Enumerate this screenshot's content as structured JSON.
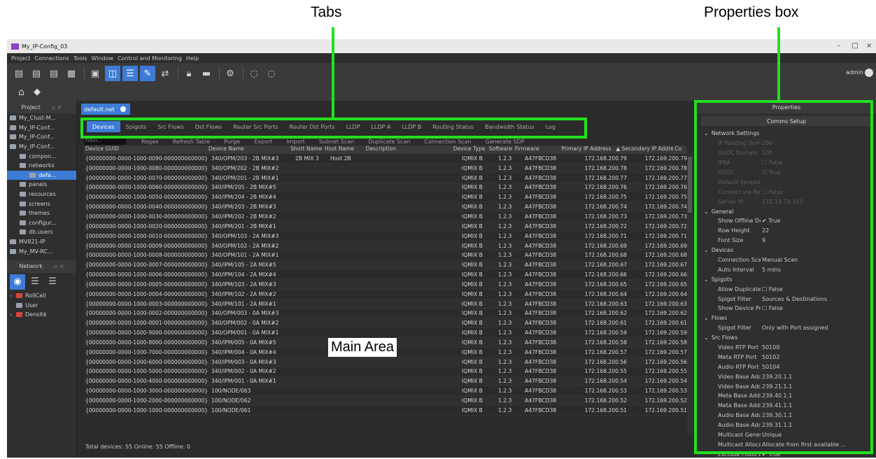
{
  "annotations": {
    "tabs": "Tabs",
    "properties_box": "Properties box",
    "main_area": "Main Area"
  },
  "window": {
    "title": "My_IP-Config_03",
    "minimize": "–",
    "maximize": "□",
    "close": "×"
  },
  "menu": [
    "Project",
    "Connections",
    "Tools",
    "Window",
    "Control and Monitoring",
    "Help"
  ],
  "toolbar": {
    "user": "admin"
  },
  "left_panel": {
    "project_title": "Project",
    "project_items": [
      {
        "label": "My_Clust-M...",
        "indent": 0,
        "sel": false
      },
      {
        "label": "My_IP-Conf...",
        "indent": 0,
        "sel": false
      },
      {
        "label": "My_IP-Conf...",
        "indent": 0,
        "sel": false
      },
      {
        "label": "My_IP-Conf...",
        "indent": 0,
        "sel": false
      },
      {
        "label": "compon...",
        "indent": 1,
        "sel": false
      },
      {
        "label": "networks",
        "indent": 1,
        "sel": false
      },
      {
        "label": "defa...",
        "indent": 2,
        "sel": true
      },
      {
        "label": "panels",
        "indent": 1,
        "sel": false
      },
      {
        "label": "resources",
        "indent": 1,
        "sel": false
      },
      {
        "label": "screens",
        "indent": 1,
        "sel": false
      },
      {
        "label": "themes",
        "indent": 1,
        "sel": false
      },
      {
        "label": "configur...",
        "indent": 1,
        "sel": false
      },
      {
        "label": "db.users",
        "indent": 1,
        "sel": false
      },
      {
        "label": "MV821-IP",
        "indent": 0,
        "sel": false
      },
      {
        "label": "My_MV-RC...",
        "indent": 0,
        "sel": false
      }
    ],
    "network_title": "Network",
    "network_items": [
      "RollCall",
      "User",
      "Densité"
    ]
  },
  "doc_tab": "default.net",
  "tabs": [
    "Devices",
    "Spigots",
    "Src Flows",
    "Dst Flows",
    "Router Src Ports",
    "Router Dst Ports",
    "LLDP",
    "LLDP A",
    "LLDP B",
    "Routing Status",
    "Bandwidth Status",
    "Log"
  ],
  "actions": {
    "filter_placeholder": "Filter...",
    "buttons": [
      "Regex",
      "Refresh Table",
      "Purge",
      "Export",
      "Import",
      "Subnet Scan",
      "Duplicate Scan",
      "Connection Scan",
      "Generate SDP"
    ]
  },
  "columns": [
    "Device GUID",
    "Device Name",
    "Short Name",
    "Host Name",
    "Description",
    "Device Type",
    "Software",
    "Firmware",
    "Primary IP Address",
    "▲ Secondary IP Address",
    "Co"
  ],
  "rows": [
    [
      "{00000000-0000-1000-0090-000000000000}",
      "340/OPM/203 - 2B MIX#3",
      "2B MIX 3",
      "Host 2B",
      "",
      "IQMIX B",
      "1.2.3",
      "A47FBCD38",
      "172.168.200.79",
      "172.169.200.79"
    ],
    [
      "{00000000-0000-1000-0080-000000000000}",
      "340/OPM/202 - 2B MIX#2",
      "",
      "",
      "",
      "IQMIX B",
      "1.2.3",
      "A47FBCD38",
      "172.168.200.78",
      "172.169.200.78"
    ],
    [
      "{00000000-0000-1000-0070-000000000000}",
      "340/OPM/201 - 2B MIX#1",
      "",
      "",
      "",
      "IQMIX B",
      "1.2.3",
      "A47FBCD38",
      "172.168.200.77",
      "172.169.200.77"
    ],
    [
      "{00000000-0000-1000-0060-000000000000}",
      "340/IPM/205 - 2B MIX#5",
      "",
      "",
      "",
      "IQMIX B",
      "1.2.3",
      "A47FBCD38",
      "172.168.200.76",
      "172.169.200.76"
    ],
    [
      "{00000000-0000-1000-0050-000000000000}",
      "340/IPM/204 - 2B MIX#4",
      "",
      "",
      "",
      "IQMIX B",
      "1.2.3",
      "A47FBCD38",
      "172.168.200.75",
      "172.169.200.75"
    ],
    [
      "{00000000-0000-1000-0040-000000000000}",
      "340/IPM/203 - 2B MIX#3",
      "",
      "",
      "",
      "IQMIX B",
      "1.2.3",
      "A47FBCD38",
      "172.168.200.74",
      "172.169.200.74"
    ],
    [
      "{00000000-0000-1000-0030-000000000000}",
      "340/IPM/202 - 2B MIX#2",
      "",
      "",
      "",
      "IQMIX B",
      "1.2.3",
      "A47FBCD38",
      "172.168.200.73",
      "172.169.200.73"
    ],
    [
      "{00000000-0000-1000-0020-000000000000}",
      "340/IPM/201 - 2B MIX#1",
      "",
      "",
      "",
      "IQMIX B",
      "1.2.3",
      "A47FBCD38",
      "172.168.200.72",
      "172.169.200.72"
    ],
    [
      "{00000000-0000-1000-0010-000000000000}",
      "340/OPM/103 - 2A MIX#3",
      "",
      "",
      "",
      "IQMIX B",
      "1.2.3",
      "A47FBCD38",
      "172.168.200.71",
      "172.169.200.71"
    ],
    [
      "{00000000-0000-1000-0009-000000000000}",
      "340/OPM/102 - 2A MIX#2",
      "",
      "",
      "",
      "IQMIX B",
      "1.2.3",
      "A47FBCD38",
      "172.168.200.69",
      "172.169.200.69"
    ],
    [
      "{00000000-0000-1000-0008-000000000000}",
      "340/OPM/101 - 2A MIX#1",
      "",
      "",
      "",
      "IQMIX B",
      "1.2.3",
      "A47FBCD38",
      "172.168.200.68",
      "172.169.200.68"
    ],
    [
      "{00000000-0000-1000-0007-000000000000}",
      "340/IPM/105 - 2A MIX#5",
      "",
      "",
      "",
      "IQMIX B",
      "1.2.3",
      "A47FBCD38",
      "172.168.200.67",
      "172.169.200.67"
    ],
    [
      "{00000000-0000-1000-0006-000000000000}",
      "340/IPM/104 - 2A MIX#4",
      "",
      "",
      "",
      "IQMIX B",
      "1.2.3",
      "A47FBCD38",
      "172.168.200.66",
      "172.169.200.66"
    ],
    [
      "{00000000-0000-1000-0005-000000000000}",
      "340/IPM/103 - 2A MIX#3",
      "",
      "",
      "",
      "IQMIX B",
      "1.2.3",
      "A47FBCD38",
      "172.168.200.65",
      "172.169.200.65"
    ],
    [
      "{00000000-0000-1000-0004-000000000000}",
      "340/IPM/102 - 2A MIX#2",
      "",
      "",
      "",
      "IQMIX B",
      "1.2.3",
      "A47FBCD38",
      "172.168.200.64",
      "172.169.200.64"
    ],
    [
      "{00000000-0000-1000-0003-000000000000}",
      "340/IPM/101 - 2A MIX#1",
      "",
      "",
      "",
      "IQMIX B",
      "1.2.3",
      "A47FBCD38",
      "172.168.200.63",
      "172.169.200.63"
    ],
    [
      "{00000000-0000-1000-0002-000000000000}",
      "340/OPM/003 - 0A MIX#3",
      "",
      "",
      "",
      "IQMIX B",
      "1.2.3",
      "A47FBCD38",
      "172.168.200.62",
      "172.169.200.62"
    ],
    [
      "{00000000-0000-1000-0001-000000000000}",
      "340/OPM/002 - 0A MIX#2",
      "",
      "",
      "",
      "IQMIX B",
      "1.2.3",
      "A47FBCD38",
      "172.168.200.61",
      "172.169.200.61"
    ],
    [
      "{00000000-0000-1000-9000-000000000000}",
      "340/OPM/001 - 0A MIX#1",
      "",
      "",
      "",
      "IQMIX B",
      "1.2.3",
      "A47FBCD38",
      "172.168.200.59",
      "172.169.200.59"
    ],
    [
      "{00000000-0000-1000-8000-000000000000}",
      "340/IPM/005 - 0A MIX#5",
      "",
      "",
      "",
      "IQMIX B",
      "1.2.3",
      "A47FBCD38",
      "172.168.200.58",
      "172.169.200.58"
    ],
    [
      "{00000000-0000-1000-7000-000000000000}",
      "340/IPM/004 - 0A MIX#4",
      "",
      "",
      "",
      "IQMIX B",
      "1.2.3",
      "A47FBCD38",
      "172.168.200.57",
      "172.169.200.57"
    ],
    [
      "{00000000-0000-1000-6000-000000000000}",
      "340/IPM/003 - 0A MIX#3",
      "",
      "",
      "",
      "IQMIX B",
      "1.2.3",
      "A47FBCD38",
      "172.168.200.56",
      "172.169.200.56"
    ],
    [
      "{00000000-0000-1000-5000-000000000000}",
      "340/IPM/002 - 0A MIX#2",
      "",
      "",
      "",
      "IQMIX B",
      "1.2.3",
      "A47FBCD38",
      "172.168.200.55",
      "172.169.200.55"
    ],
    [
      "{00000000-0000-1000-4000-000000000000}",
      "340/IPM/001 - 0A MIX#1",
      "",
      "",
      "",
      "IQMIX B",
      "1.2.3",
      "A47FBCD38",
      "172.168.200.54",
      "172.169.200.54"
    ],
    [
      "{00000000-0000-1000-3000-000000000000}",
      "100/NODE/063",
      "",
      "",
      "",
      "IQMIX B",
      "1.2.3",
      "A47FBCD38",
      "172.168.200.53",
      "172.169.200.53"
    ],
    [
      "{00000000-0000-1000-2000-000000000000}",
      "100/NODE/062",
      "",
      "",
      "",
      "IQMIX B",
      "1.2.3",
      "A47FBCD38",
      "172.168.200.52",
      "172.169.200.52"
    ],
    [
      "{00000000-0000-1000-1000-000000000000}",
      "100/NODE/061",
      "",
      "",
      "",
      "IQMIX B",
      "1.2.3",
      "A47FBCD38",
      "172.168.200.51",
      "172.169.200.51"
    ]
  ],
  "status": "Total devices: 55   Online: 55   Offline: 0",
  "properties": {
    "title": "Properties",
    "comms_button": "Comms Setup",
    "items": [
      {
        "t": "s",
        "k": "Network Settings"
      },
      {
        "t": "d",
        "k": "IP Routing Domain",
        "v": "206"
      },
      {
        "t": "d",
        "k": "GVOC Domain",
        "v": "105"
      },
      {
        "t": "d",
        "k": "IPRA",
        "v": "☐ False"
      },
      {
        "t": "d",
        "k": "GVOC",
        "v": "☑ True"
      },
      {
        "t": "d",
        "k": "Default Spreadsheet",
        "v": ""
      },
      {
        "t": "d",
        "k": "Connect via Relay",
        "v": "☐ False"
      },
      {
        "t": "d",
        "k": "Server IP",
        "v": "172.19.79.143"
      },
      {
        "t": "s",
        "k": "General"
      },
      {
        "t": "p",
        "k": "Show Offline Devi...",
        "v": "✔ True"
      },
      {
        "t": "p",
        "k": "Row Height",
        "v": "22"
      },
      {
        "t": "p",
        "k": "Font Size",
        "v": "9"
      },
      {
        "t": "s",
        "k": "Devices"
      },
      {
        "t": "p",
        "k": "Connection Scan",
        "v": "Manual Scan"
      },
      {
        "t": "p",
        "k": "Auto Interval",
        "v": "5 mins"
      },
      {
        "t": "s",
        "k": "Spigots"
      },
      {
        "t": "p",
        "k": "Allow Duplicate N...",
        "v": "☐ False"
      },
      {
        "t": "p",
        "k": "Spigot Filter",
        "v": "Sources & Destinations"
      },
      {
        "t": "p",
        "k": "Show Device Proxy",
        "v": "☐ False"
      },
      {
        "t": "s",
        "k": "Flows"
      },
      {
        "t": "p",
        "k": "Spigot Filter",
        "v": "Only with Port assigned"
      },
      {
        "t": "s",
        "k": "Src Flows"
      },
      {
        "t": "p",
        "k": "Video RTP Port",
        "v": "50100"
      },
      {
        "t": "p",
        "k": "Meta RTP Port",
        "v": "50102"
      },
      {
        "t": "p",
        "k": "Audio RTP Port",
        "v": "50104"
      },
      {
        "t": "p",
        "k": "Video Base Addre...",
        "v": "239.20.1.1"
      },
      {
        "t": "p",
        "k": "Video Base Addre...",
        "v": "239.21.1.1"
      },
      {
        "t": "p",
        "k": "Meta Base Addres...",
        "v": "239.40.1.1"
      },
      {
        "t": "p",
        "k": "Meta Base Addres...",
        "v": "239.41.1.1"
      },
      {
        "t": "p",
        "k": "Audio Base Addre...",
        "v": "239.30.1.1"
      },
      {
        "t": "p",
        "k": "Audio Base Addre...",
        "v": "239.31.1.1"
      },
      {
        "t": "p",
        "k": "Multicast Generation",
        "v": "Unique"
      },
      {
        "t": "p",
        "k": "Multicast Allocation",
        "v": "Allocate from first available ..."
      },
      {
        "t": "p",
        "k": "Exclude Flood Add...",
        "v": "✔ True"
      }
    ]
  }
}
